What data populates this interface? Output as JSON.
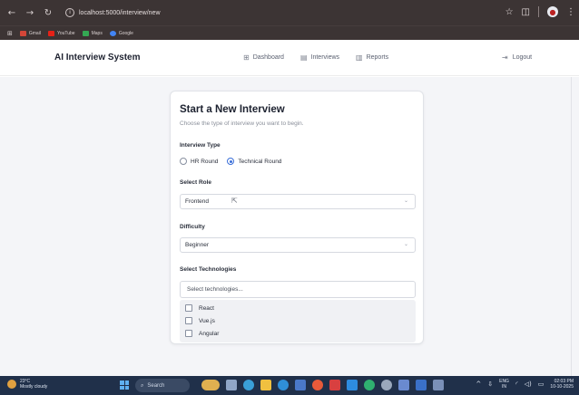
{
  "browser": {
    "url": "localhost:5000/interview/new",
    "bookmarks": [
      {
        "label": "Gmail",
        "color": "#d44638"
      },
      {
        "label": "YouTube",
        "color": "#e62117"
      },
      {
        "label": "Maps",
        "color": "#34a853"
      },
      {
        "label": "Google",
        "color": "#4285f4"
      }
    ]
  },
  "header": {
    "brand": "AI Interview System",
    "nav": [
      {
        "label": "Dashboard",
        "icon": "grid-icon"
      },
      {
        "label": "Interviews",
        "icon": "clipboard-icon"
      },
      {
        "label": "Reports",
        "icon": "document-icon"
      }
    ],
    "logout": "Logout"
  },
  "form": {
    "title": "Start a New Interview",
    "subtitle": "Choose the type of interview you want to begin.",
    "interview_type_label": "Interview Type",
    "interview_types": [
      {
        "label": "HR Round",
        "selected": false
      },
      {
        "label": "Technical Round",
        "selected": true
      }
    ],
    "role_label": "Select Role",
    "role_value": "Frontend",
    "difficulty_label": "Difficulty",
    "difficulty_value": "Beginner",
    "tech_label": "Select Technologies",
    "tech_placeholder": "Select technologies...",
    "tech_options": [
      {
        "label": "React",
        "checked": false
      },
      {
        "label": "Vue.js",
        "checked": false
      },
      {
        "label": "Angular",
        "checked": false
      }
    ]
  },
  "taskbar": {
    "weather_temp": "23°C",
    "weather_desc": "Mostly cloudy",
    "search": "Search",
    "lang_top": "ENG",
    "lang_bottom": "IN",
    "time": "02:03 PM",
    "date": "10-10-2025"
  },
  "colors": {
    "accent": "#3b6fd8",
    "browser_bar": "#3c3434",
    "taskbar": "#20304a"
  }
}
